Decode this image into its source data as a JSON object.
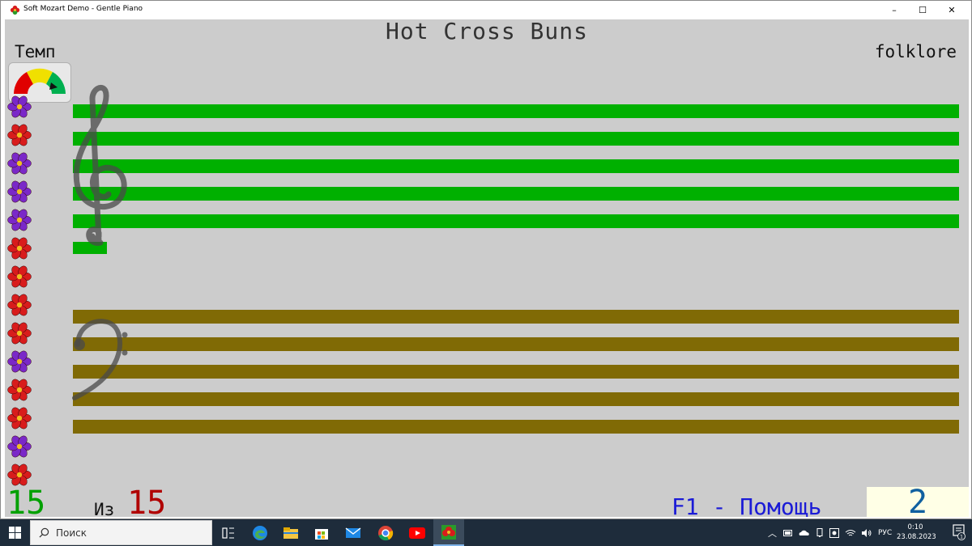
{
  "window": {
    "title": "Soft Mozart Demo - Gentle Piano",
    "controls": {
      "minimize": "–",
      "maximize": "☐",
      "close": "✕"
    }
  },
  "song": {
    "title": "Hot Cross Buns",
    "composer": "folklore"
  },
  "tempo": {
    "label": "Темп",
    "gauge_colors": {
      "slow": "#e00000",
      "medium": "#f0e000",
      "fast": "#00b050"
    },
    "gauge_setting": "fast"
  },
  "flowers": [
    "purple",
    "red",
    "purple",
    "purple",
    "purple",
    "red",
    "red",
    "red",
    "red",
    "purple",
    "red",
    "red",
    "purple",
    "red"
  ],
  "flower_colors": {
    "purple": "#7a28c8",
    "red": "#d81c1c",
    "center": "#f0c020"
  },
  "staff": {
    "treble_color": "#00b000",
    "bass_color": "#806a05",
    "treble_clef_icon": "treble-clef-icon",
    "bass_clef_icon": "bass-clef-icon"
  },
  "progress": {
    "current": "15",
    "of_label": "Из",
    "total": "15"
  },
  "help": "F1 - Помощь",
  "score": "2",
  "taskbar": {
    "search_placeholder": "Поиск",
    "apps": [
      "task-view-icon",
      "edge-icon",
      "file-explorer-icon",
      "store-icon",
      "mail-icon",
      "chrome-icon",
      "youtube-icon",
      "soft-mozart-icon"
    ],
    "language": "РУС",
    "time": "0:10",
    "date": "23.08.2023",
    "notifications": "1"
  }
}
